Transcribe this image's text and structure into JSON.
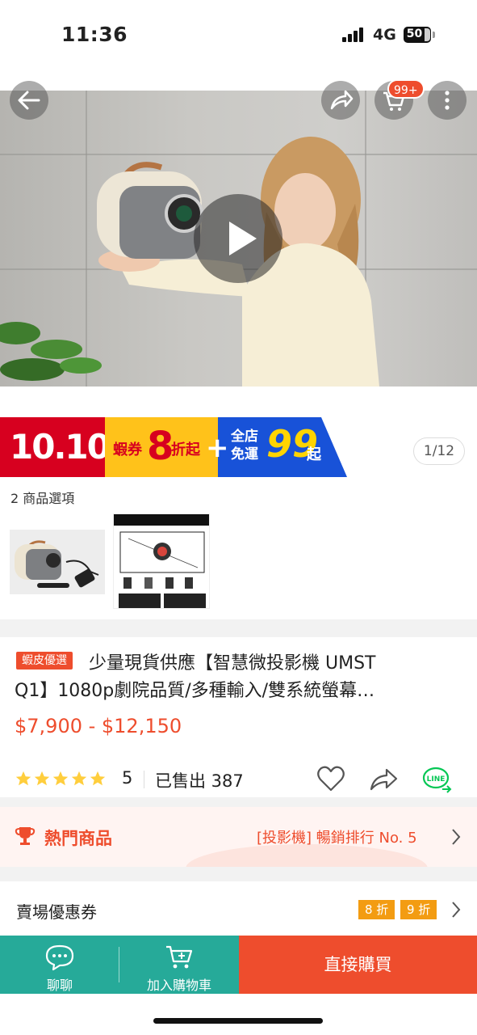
{
  "status_bar": {
    "time": "11:36",
    "network": "4G",
    "battery": "50"
  },
  "top_bar": {
    "cart_badge": "99+"
  },
  "promo": {
    "red_text": "10.10",
    "yellow_prefix": "蝦券",
    "yellow_number": "8",
    "yellow_suffix": "折起",
    "plus": "+",
    "blue_text": "全店免運",
    "blue_number": "99",
    "blue_suffix": "起"
  },
  "image_counter": "1/12",
  "options": {
    "label": "2 商品選項"
  },
  "product": {
    "tag": "蝦皮優選",
    "title_line1": "少量現貨供應【智慧微投影機 UMST",
    "title_line2": "Q1】1080p劇院品質/多種輸入/雙系統螢幕…",
    "price": "$7,900 - $12,150",
    "rating": "5",
    "sold": "已售出 387",
    "star_color": "#ffce3d"
  },
  "hot": {
    "title": "熱門商品",
    "rank": "[投影機] 暢銷排行 No. 5"
  },
  "vouchers": {
    "title": "賣場優惠券",
    "chips": [
      "8 折",
      "9 折"
    ]
  },
  "bottom_bar": {
    "chat": "聊聊",
    "add_cart": "加入購物車",
    "buy_now": "直接購買"
  },
  "colors": {
    "brand": "#ee4d2d",
    "teal": "#26aa99"
  }
}
